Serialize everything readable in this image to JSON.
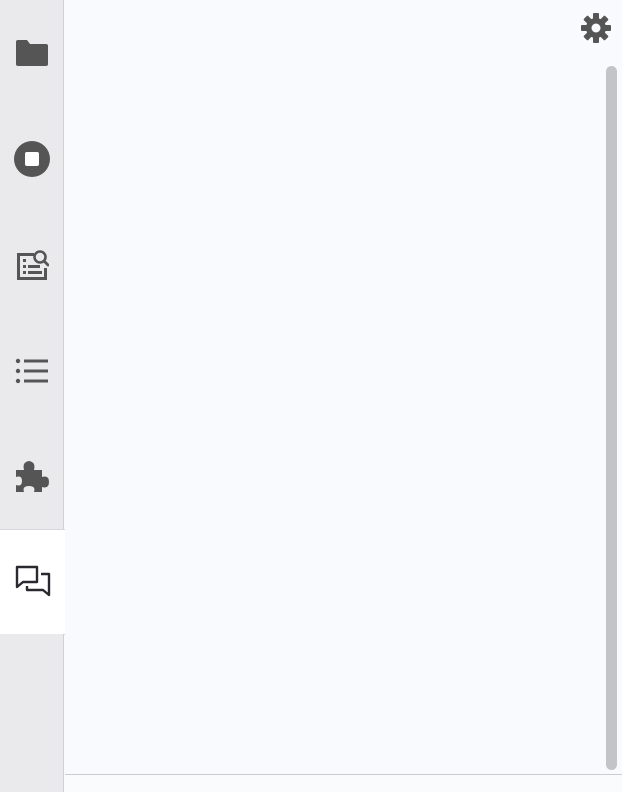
{
  "activity_bar": {
    "tabs": [
      {
        "id": "files",
        "icon": "folder-icon",
        "active": false
      },
      {
        "id": "running",
        "icon": "stop-circle-icon",
        "active": false
      },
      {
        "id": "inspector",
        "icon": "property-inspector-icon",
        "active": false
      },
      {
        "id": "toc",
        "icon": "list-icon",
        "active": false
      },
      {
        "id": "extensions",
        "icon": "puzzle-piece-icon",
        "active": false
      },
      {
        "id": "chat",
        "icon": "chat-bubbles-icon",
        "active": true
      }
    ]
  },
  "main_panel": {
    "settings_icon": "gear-icon",
    "scrollbar": {
      "thumb_fraction": 1.0
    }
  },
  "colors": {
    "sidebar_bg": "#eaeaec",
    "active_tab_bg": "#ffffff",
    "panel_bg": "#f8fafd",
    "icon": "#555555",
    "active_icon": "#2b2830",
    "scrollbar_thumb": "#c3c4c7"
  }
}
